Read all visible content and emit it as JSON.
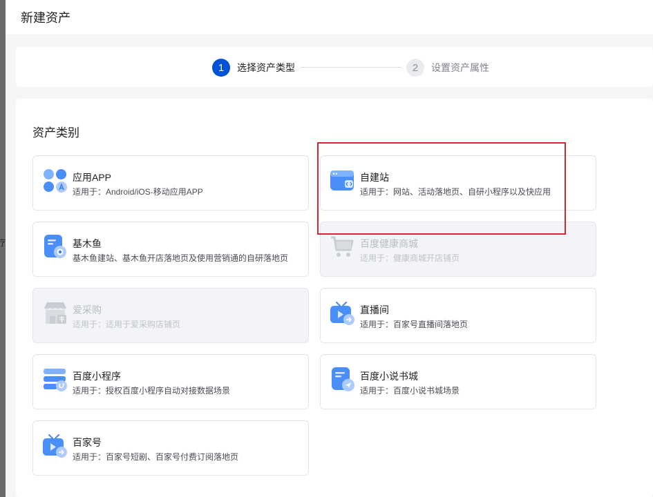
{
  "drawer": {
    "title": "新建资产"
  },
  "left_glyph": "疗",
  "steps": [
    {
      "number": "1",
      "label": "选择资产类型",
      "state": "active"
    },
    {
      "number": "2",
      "label": "设置资产属性",
      "state": "inactive"
    }
  ],
  "section": {
    "title": "资产类别"
  },
  "assets": [
    {
      "name": "应用APP",
      "desc": "适用于：Android/iOS-移动应用APP",
      "icon": "app-grid-icon",
      "disabled": false
    },
    {
      "name": "自建站",
      "desc": "适用于：网站、活动落地页、自研小程序以及快应用",
      "icon": "browser-code-icon",
      "disabled": false
    },
    {
      "name": "基木鱼",
      "desc": "基木鱼建站、基木鱼开店落地页及使用营销通的自研落地页",
      "icon": "document-eye-icon",
      "disabled": false
    },
    {
      "name": "百度健康商城",
      "desc": "适用于：健康商城开店铺页",
      "icon": "shopping-cart-icon",
      "disabled": true
    },
    {
      "name": "爱采购",
      "desc": "适用于：适用于爱采购店铺页",
      "icon": "storefront-icon",
      "disabled": true
    },
    {
      "name": "直播间",
      "desc": "适用于：百家号直播间落地页",
      "icon": "tv-play-icon",
      "disabled": false
    },
    {
      "name": "百度小程序",
      "desc": "适用于：授权百度小程序自动对接数据场景",
      "icon": "mini-program-icon",
      "disabled": false
    },
    {
      "name": "百度小说书城",
      "desc": "适用于：百度小说书城场景",
      "icon": "book-send-icon",
      "disabled": false
    },
    {
      "name": "百家号",
      "desc": "适用于：百家号短剧、百家号付费订阅落地页",
      "icon": "tv-play-icon",
      "disabled": false
    }
  ],
  "colors": {
    "primary": "#0052d9",
    "icon_light": "#7fb2ff",
    "icon_dark": "#2f7bf5",
    "highlight": "#d9262c",
    "disabled_icon": "#c9ccd2"
  }
}
